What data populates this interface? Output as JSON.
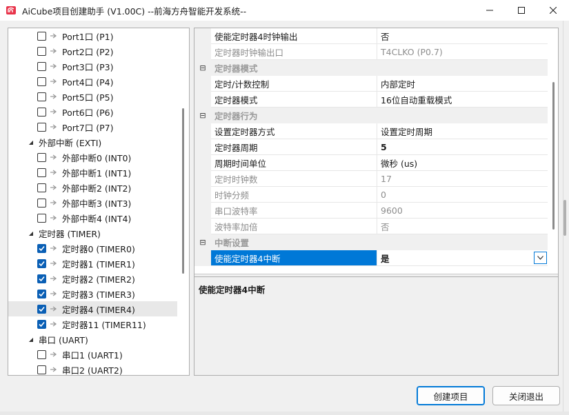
{
  "window": {
    "title": "AiCube项目创建助手 (V1.00C) --前海方舟智能开发系统--",
    "minimize": "—",
    "maximize": "☐",
    "close": "✕"
  },
  "tree": [
    {
      "label": "Port1口 (P1)",
      "type": "leaf",
      "checked": false
    },
    {
      "label": "Port2口 (P2)",
      "type": "leaf",
      "checked": false
    },
    {
      "label": "Port3口 (P3)",
      "type": "leaf",
      "checked": false
    },
    {
      "label": "Port4口 (P4)",
      "type": "leaf",
      "checked": false
    },
    {
      "label": "Port5口 (P5)",
      "type": "leaf",
      "checked": false
    },
    {
      "label": "Port6口 (P6)",
      "type": "leaf",
      "checked": false
    },
    {
      "label": "Port7口 (P7)",
      "type": "leaf",
      "checked": false
    },
    {
      "label": "外部中断 (EXTI)",
      "type": "group"
    },
    {
      "label": "外部中断0 (INT0)",
      "type": "leaf",
      "checked": false
    },
    {
      "label": "外部中断1 (INT1)",
      "type": "leaf",
      "checked": false
    },
    {
      "label": "外部中断2 (INT2)",
      "type": "leaf",
      "checked": false
    },
    {
      "label": "外部中断3 (INT3)",
      "type": "leaf",
      "checked": false
    },
    {
      "label": "外部中断4 (INT4)",
      "type": "leaf",
      "checked": false
    },
    {
      "label": "定时器 (TIMER)",
      "type": "group"
    },
    {
      "label": "定时器0 (TIMER0)",
      "type": "leaf",
      "checked": true
    },
    {
      "label": "定时器1 (TIMER1)",
      "type": "leaf",
      "checked": true
    },
    {
      "label": "定时器2 (TIMER2)",
      "type": "leaf",
      "checked": true
    },
    {
      "label": "定时器3 (TIMER3)",
      "type": "leaf",
      "checked": true
    },
    {
      "label": "定时器4 (TIMER4)",
      "type": "leaf",
      "checked": true,
      "selected": true
    },
    {
      "label": "定时器11 (TIMER11)",
      "type": "leaf",
      "checked": true
    },
    {
      "label": "串口 (UART)",
      "type": "group"
    },
    {
      "label": "串口1 (UART1)",
      "type": "leaf",
      "checked": false
    },
    {
      "label": "串口2 (UART2)",
      "type": "leaf",
      "checked": false
    }
  ],
  "props": [
    {
      "kind": "row",
      "name": "使能定时器4时钟输出",
      "value": "否"
    },
    {
      "kind": "row",
      "name": "定时器时钟输出口",
      "value": "T4CLKO (P0.7)",
      "disabled": true
    },
    {
      "kind": "cat",
      "name": "定时器模式"
    },
    {
      "kind": "row",
      "name": "定时/计数控制",
      "value": "内部定时"
    },
    {
      "kind": "row",
      "name": "定时器模式",
      "value": "16位自动重载模式"
    },
    {
      "kind": "cat",
      "name": "定时器行为"
    },
    {
      "kind": "row",
      "name": "设置定时器方式",
      "value": "设置定时周期"
    },
    {
      "kind": "row",
      "name": "定时器周期",
      "value": "5",
      "bold": true
    },
    {
      "kind": "row",
      "name": "周期时间单位",
      "value": "微秒 (us)"
    },
    {
      "kind": "row",
      "name": "定时时钟数",
      "value": "17",
      "disabled": true
    },
    {
      "kind": "row",
      "name": "时钟分频",
      "value": "0",
      "disabled": true
    },
    {
      "kind": "row",
      "name": "串口波特率",
      "value": "9600",
      "disabled": true
    },
    {
      "kind": "row",
      "name": "波特率加倍",
      "value": "否",
      "disabled": true
    },
    {
      "kind": "cat",
      "name": "中断设置"
    },
    {
      "kind": "row",
      "name": "使能定时器4中断",
      "value": "是",
      "selected": true
    }
  ],
  "description": "使能定时器4中断",
  "buttons": {
    "create": "创建项目",
    "close": "关闭退出"
  },
  "colors": {
    "accent": "#0078d7",
    "checkbox_checked": "#0a5fb5",
    "disabled_text": "#8d8d8d"
  }
}
